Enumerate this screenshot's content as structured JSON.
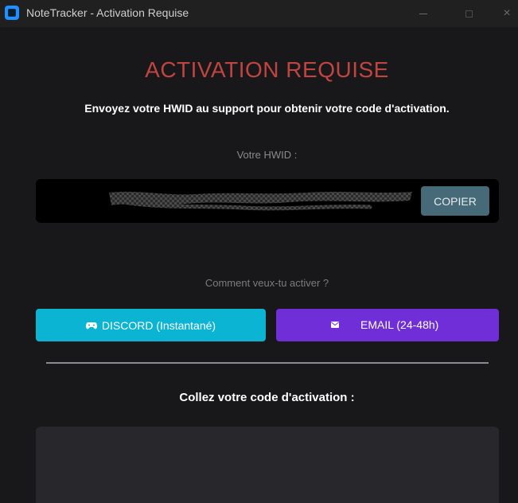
{
  "window": {
    "title": "NoteTracker - Activation Requise",
    "minimize": "",
    "maximize": "",
    "close": "×"
  },
  "heading": "ACTIVATION REQUISE",
  "subtitle": "Envoyez votre HWID au support pour obtenir votre code d'activation.",
  "hwid": {
    "label": "Votre HWID :",
    "value": "",
    "copy_label": "COPIER"
  },
  "activation_method": {
    "label": "Comment veux-tu activer ?",
    "discord_label": "DISCORD (Instantané)",
    "email_label": "EMAIL (24-48h)"
  },
  "code": {
    "label": "Collez votre code d'activation :",
    "value": ""
  },
  "icons": {
    "app": "app-icon",
    "discord": "gamepad-icon",
    "email": "envelope-icon"
  },
  "colors": {
    "accent_red": "#c0443f",
    "copy_button": "#476a78",
    "discord_button": "#0bb4d2",
    "email_button": "#6f2ed8",
    "background": "#18181b"
  }
}
